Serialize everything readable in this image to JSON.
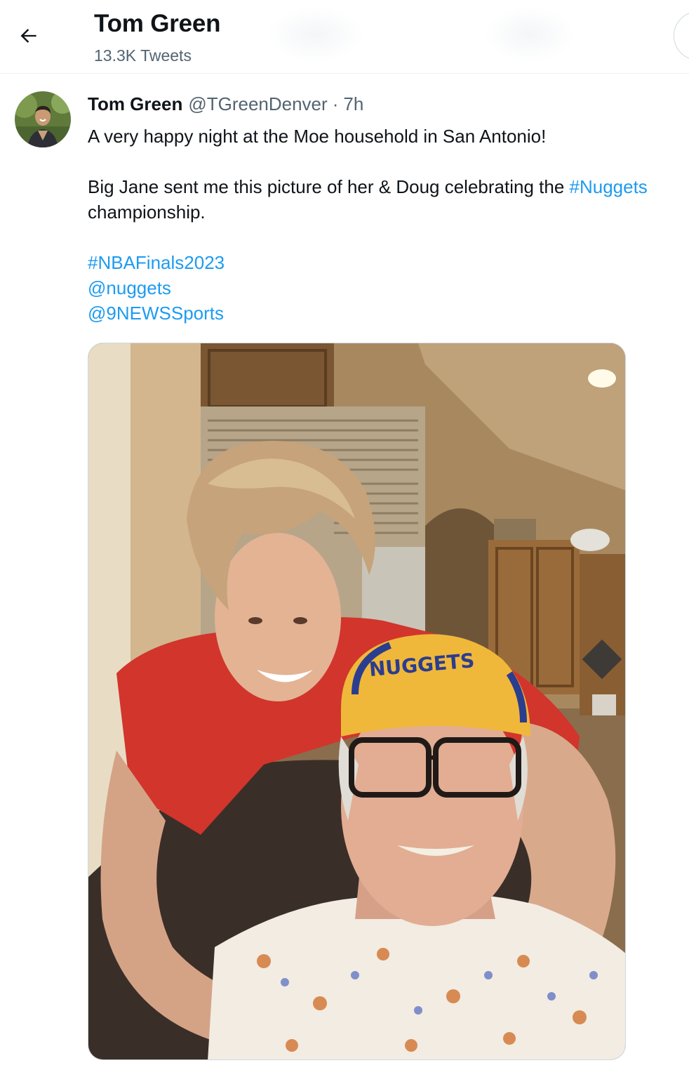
{
  "header": {
    "title": "Tom Green",
    "subtitle": "13.3K Tweets",
    "back_icon": "arrow-left-icon"
  },
  "tweet": {
    "author": {
      "display_name": "Tom Green",
      "handle": "@TGreenDenver",
      "separator": "·",
      "time": "7h"
    },
    "text": {
      "line1": "A very happy night at the Moe household in San Antonio!",
      "line2_text": "Big Jane sent me this picture of her & Doug celebrating the ",
      "line2_link": "#Nuggets",
      "line3": "championship.",
      "hashtag": "#NBAFinals2023",
      "mention1": "@nuggets",
      "mention2": "@9NEWSSports"
    },
    "photo": {
      "cap_text": "NUGGETS"
    }
  },
  "colors": {
    "link": "#1d9bf0",
    "secondary_text": "#536471",
    "primary_text": "#0f1419",
    "divider": "#eff3f4"
  }
}
